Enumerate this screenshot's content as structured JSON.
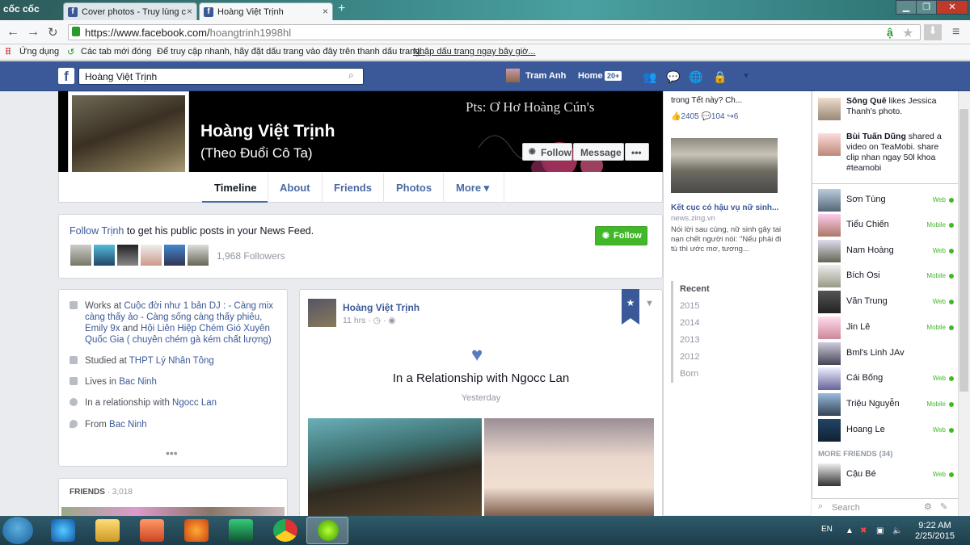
{
  "browser": {
    "name": "cốc cốc",
    "tabs": [
      {
        "label": "Cover photos - Truy lùng c"
      },
      {
        "label": "Hoàng Việt Trịnh"
      }
    ],
    "url_host": "https://www.facebook.com/",
    "url_path": "hoangtrinh1998hl",
    "bookmarks": {
      "apps": "Ứng dụng",
      "recent_tabs": "Các tab mới đóng",
      "hint": "Để truy cập nhanh, hãy đặt dấu trang vào đây trên thanh dấu trang.",
      "import_link": "Nhập dấu trang ngay bây giờ..."
    }
  },
  "fb_header": {
    "search_value": "Hoàng Việt Trịnh",
    "user_name": "Tram Anh",
    "home_label": "Home",
    "home_badge": "20+"
  },
  "profile": {
    "cover_text": "Pts: Ơ Hơ Hoàng Cún's",
    "name": "Hoàng Việt Trịnh",
    "alt_name": "(Theo Đuổi Cô Ta)",
    "follow_label": "Follow",
    "message_label": "Message",
    "more_dots": "•••",
    "tabs": [
      "Timeline",
      "About",
      "Friends",
      "Photos",
      "More ▾"
    ]
  },
  "follow_box": {
    "link": "Follow Trịnh",
    "text": " to get his public posts in your News Feed.",
    "button": "Follow",
    "followers": "1,968 Followers"
  },
  "intro": {
    "works_prefix": "Works at ",
    "works_link": "Cuộc đời như 1 bản DJ : - Càng mix càng thấy ảo - Càng sống càng thấy phiêu, Emily 9x",
    "works_and": " and ",
    "works_link2": "Hội Liên Hiệp Chém Gió Xuyên Quốc Gia ( chuyên chém gà kém chất lượng)",
    "studied_prefix": "Studied at ",
    "studied_link": "THPT Lý Nhân Tông",
    "lives_prefix": "Lives in ",
    "lives_link": "Bac Ninh",
    "rel_prefix": "In a relationship with ",
    "rel_link": "Ngocc Lan",
    "from_prefix": "From ",
    "from_link": "Bac Ninh",
    "more": "•••"
  },
  "friends_card": {
    "label": "FRIENDS",
    "count": " · 3,018"
  },
  "post": {
    "author": "Hoàng Việt Trịnh",
    "time": "11 hrs · ◷ · ◉",
    "title": "In a Relationship with Ngocc Lan",
    "date": "Yesterday"
  },
  "ticker": {
    "top_text": "trong Tết này? Ch...",
    "stats": "👍2405  💬104  ↪6",
    "news_title": "Kết cục có hậu vụ nữ sinh...",
    "news_source": "news.zing.vn",
    "news_desc": "Nói lời sau cùng, nữ sinh gây tai nạn chết người nói: \"Nếu phải đi tù thì ước mơ, tương...",
    "years": [
      "Recent",
      "2015",
      "2014",
      "2013",
      "2012",
      "Born"
    ]
  },
  "chat": {
    "stories": [
      {
        "name": "Sông Quê",
        "text": " likes Jessica Thanh's photo."
      },
      {
        "name": "Bùi Tuấn Dũng",
        "text": " shared a video on TeaMobi. share clip nhan ngay 50l khoa #teamobi"
      }
    ],
    "contacts": [
      {
        "name": "Sơn Tùng",
        "status": "Web"
      },
      {
        "name": "Tiểu Chiến",
        "status": "Mobile"
      },
      {
        "name": "Nam Hoàng",
        "status": "Web"
      },
      {
        "name": "Bích Osi",
        "status": "Mobile"
      },
      {
        "name": "Văn Trung",
        "status": "Web"
      },
      {
        "name": "Jin Lê",
        "status": "Mobile"
      },
      {
        "name": "Bml's Linh JAv",
        "status": ""
      },
      {
        "name": "Cái Bống",
        "status": "Web"
      },
      {
        "name": "Triệu Nguyễn",
        "status": "Mobile"
      },
      {
        "name": "Hoang Le",
        "status": "Web"
      }
    ],
    "more_friends": "MORE FRIENDS (34)",
    "more_contact": {
      "name": "Cậu Bé",
      "status": "Web"
    },
    "search_placeholder": "Search"
  },
  "taskbar": {
    "lang": "EN",
    "time": "9:22 AM",
    "date": "2/25/2015"
  },
  "colors": {
    "fb_blue": "#3b5998",
    "green": "#42b72a"
  }
}
